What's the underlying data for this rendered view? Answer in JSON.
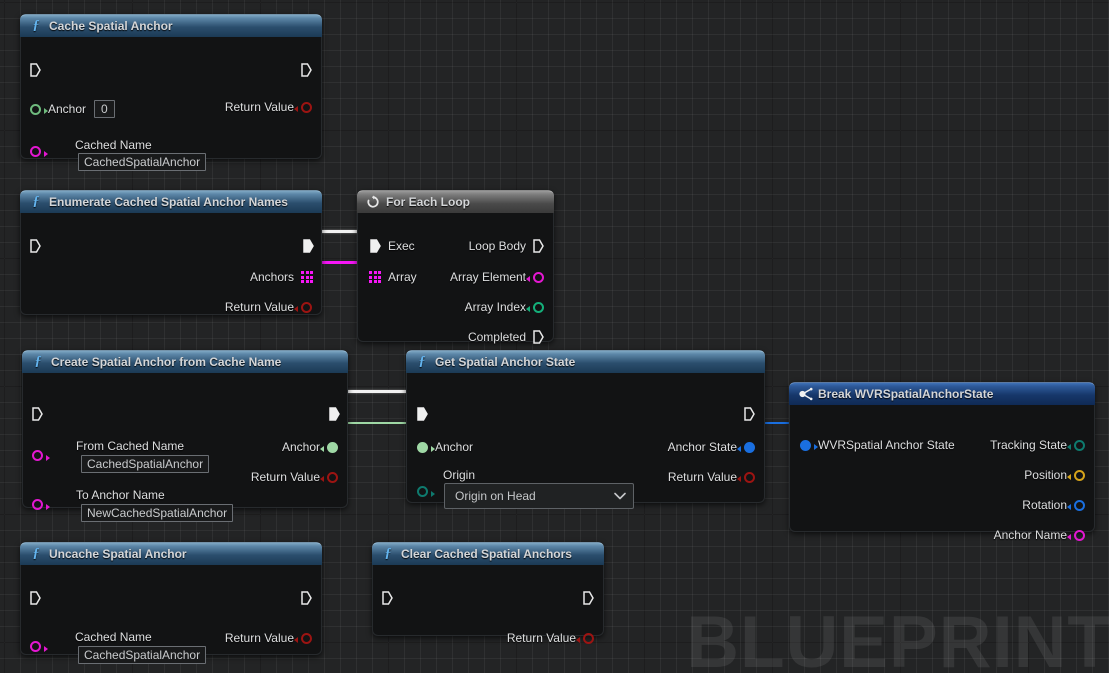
{
  "canvas": {
    "watermark": "BLUEPRINT",
    "background_color": "#232425",
    "grid_color": "#2e2f30"
  },
  "nodes": [
    {
      "id": "cache-spatial-anchor",
      "title": "Cache Spatial Anchor",
      "kind": "function",
      "icon": "function-f-icon",
      "exec_in": "",
      "exec_out": "",
      "inputs": [
        {
          "label": "Anchor",
          "color": "#6fbb7e",
          "value": "0"
        },
        {
          "label": "Cached Name",
          "color": "#e317d1",
          "value": "CachedSpatialAnchor"
        }
      ],
      "outputs": [
        {
          "label": "Return Value",
          "color": "#9c1412"
        }
      ]
    },
    {
      "id": "enumerate-cached-spatial-anchor-names",
      "title": "Enumerate Cached Spatial Anchor Names",
      "kind": "function",
      "icon": "function-f-icon",
      "outputs": [
        {
          "label": "Anchors",
          "color": "#f716f7"
        },
        {
          "label": "Return Value",
          "color": "#9c1412"
        }
      ]
    },
    {
      "id": "for-each-loop",
      "title": "For Each Loop",
      "kind": "macro",
      "icon": "loop-icon",
      "inputs": [
        {
          "label": "Exec"
        },
        {
          "label": "Array",
          "color": "#f716f7"
        }
      ],
      "outputs": [
        {
          "label": "Loop Body"
        },
        {
          "label": "Array Element",
          "color": "#e317d1"
        },
        {
          "label": "Array Index",
          "color": "#14b07a"
        },
        {
          "label": "Completed"
        }
      ]
    },
    {
      "id": "create-spatial-anchor-from-cache-name",
      "title": "Create Spatial Anchor from Cache Name",
      "kind": "function",
      "icon": "function-f-icon",
      "inputs": [
        {
          "label": "From Cached Name",
          "color": "#e317d1",
          "value": "CachedSpatialAnchor"
        },
        {
          "label": "To Anchor Name",
          "color": "#e317d1",
          "value": "NewCachedSpatialAnchor"
        }
      ],
      "outputs": [
        {
          "label": "Anchor",
          "color": "#9fd8a5"
        },
        {
          "label": "Return Value",
          "color": "#9c1412"
        }
      ]
    },
    {
      "id": "get-spatial-anchor-state",
      "title": "Get Spatial Anchor State",
      "kind": "function",
      "icon": "function-f-icon",
      "inputs": [
        {
          "label": "Anchor",
          "color": "#9fd8a5"
        },
        {
          "label": "Origin",
          "color": "#0e7a6e",
          "value": "Origin on Head"
        }
      ],
      "outputs": [
        {
          "label": "Anchor State",
          "color": "#1a6fe0"
        },
        {
          "label": "Return Value",
          "color": "#9c1412"
        }
      ]
    },
    {
      "id": "break-wvrspatialanchorstate",
      "title": "Break WVRSpatialAnchorState",
      "kind": "break",
      "icon": "break-struct-icon",
      "inputs": [
        {
          "label": "WVRSpatial Anchor State",
          "color": "#1a6fe0"
        }
      ],
      "outputs": [
        {
          "label": "Tracking State",
          "color": "#0e7a6e"
        },
        {
          "label": "Position",
          "color": "#d6a41b"
        },
        {
          "label": "Rotation",
          "color": "#1a6fe0"
        },
        {
          "label": "Anchor Name",
          "color": "#e317d1"
        }
      ]
    },
    {
      "id": "uncache-spatial-anchor",
      "title": "Uncache Spatial Anchor",
      "kind": "function",
      "icon": "function-f-icon",
      "inputs": [
        {
          "label": "Cached Name",
          "color": "#e317d1",
          "value": "CachedSpatialAnchor"
        }
      ],
      "outputs": [
        {
          "label": "Return Value",
          "color": "#9c1412"
        }
      ]
    },
    {
      "id": "clear-cached-spatial-anchors",
      "title": "Clear Cached Spatial Anchors",
      "kind": "function",
      "icon": "function-f-icon",
      "outputs": [
        {
          "label": "Return Value",
          "color": "#9c1412"
        }
      ]
    }
  ],
  "node_titles": {
    "cache": "Cache Spatial Anchor",
    "enumerate": "Enumerate Cached Spatial Anchor Names",
    "foreach": "For Each Loop",
    "create": "Create Spatial Anchor from Cache Name",
    "getstate": "Get Spatial Anchor State",
    "break": "Break WVRSpatialAnchorState",
    "uncache": "Uncache Spatial Anchor",
    "clear": "Clear Cached Spatial Anchors"
  },
  "labels": {
    "anchor": "Anchor",
    "cached_name": "Cached Name",
    "return_value": "Return Value",
    "anchors": "Anchors",
    "exec": "Exec",
    "array": "Array",
    "loop_body": "Loop Body",
    "array_element": "Array Element",
    "array_index": "Array Index",
    "completed": "Completed",
    "from_cached_name": "From Cached Name",
    "to_anchor_name": "To Anchor Name",
    "origin": "Origin",
    "anchor_state": "Anchor State",
    "wvr_spatial_anchor_state": "WVRSpatial Anchor State",
    "tracking_state": "Tracking State",
    "position": "Position",
    "rotation": "Rotation",
    "anchor_name": "Anchor Name"
  },
  "values": {
    "anchor_index": "0",
    "cached_spatial_anchor": "CachedSpatialAnchor",
    "new_cached_spatial_anchor": "NewCachedSpatialAnchor",
    "origin_on_head": "Origin on Head",
    "uncache_cached_name": "CachedSpatialAnchor"
  },
  "colors": {
    "exec_wire": "#f2f2f2",
    "name_wire": "#f716f7",
    "object_wire": "#9fd8a5",
    "struct_wire": "#1a6fe0",
    "boolean_pin": "#9c1412",
    "name_pin": "#e317d1",
    "object_pin": "#6fbb7e",
    "int_pin": "#14b07a",
    "enum_pin": "#0e7a6e",
    "vector_pin": "#d6a41b"
  }
}
